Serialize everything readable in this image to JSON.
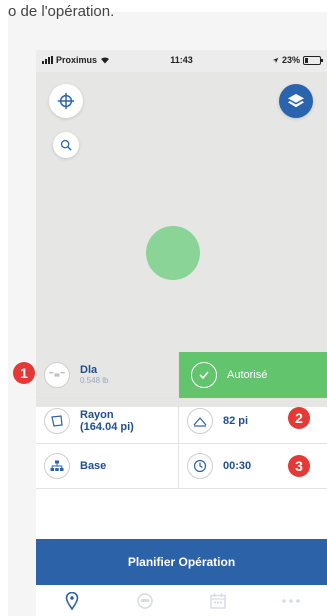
{
  "crop_text": "o de l'opération.",
  "status_bar": {
    "carrier": "Proximus",
    "time": "11:43",
    "battery": "23%"
  },
  "map": {
    "buttons": [
      "crosshair-icon",
      "search-icon",
      "layers-icon",
      "close-icon"
    ]
  },
  "details": {
    "drone_name": "Dla",
    "drone_weight": "0.548 lb",
    "status": "Autorisé",
    "radius_label": "Rayon",
    "radius_value": "(164.04 pi)",
    "altitude": "82 pi",
    "base": "Base",
    "duration": "00:30"
  },
  "badges": [
    "1",
    "2",
    "3"
  ],
  "plan_button": "Planifier Opération",
  "bottom_nav": [
    "location-pin-icon",
    "pilot-icon",
    "calendar-icon",
    "more-icon"
  ],
  "colors": {
    "accent": "#2c62a8",
    "authorized": "#62c46d",
    "badge": "#e53935"
  }
}
